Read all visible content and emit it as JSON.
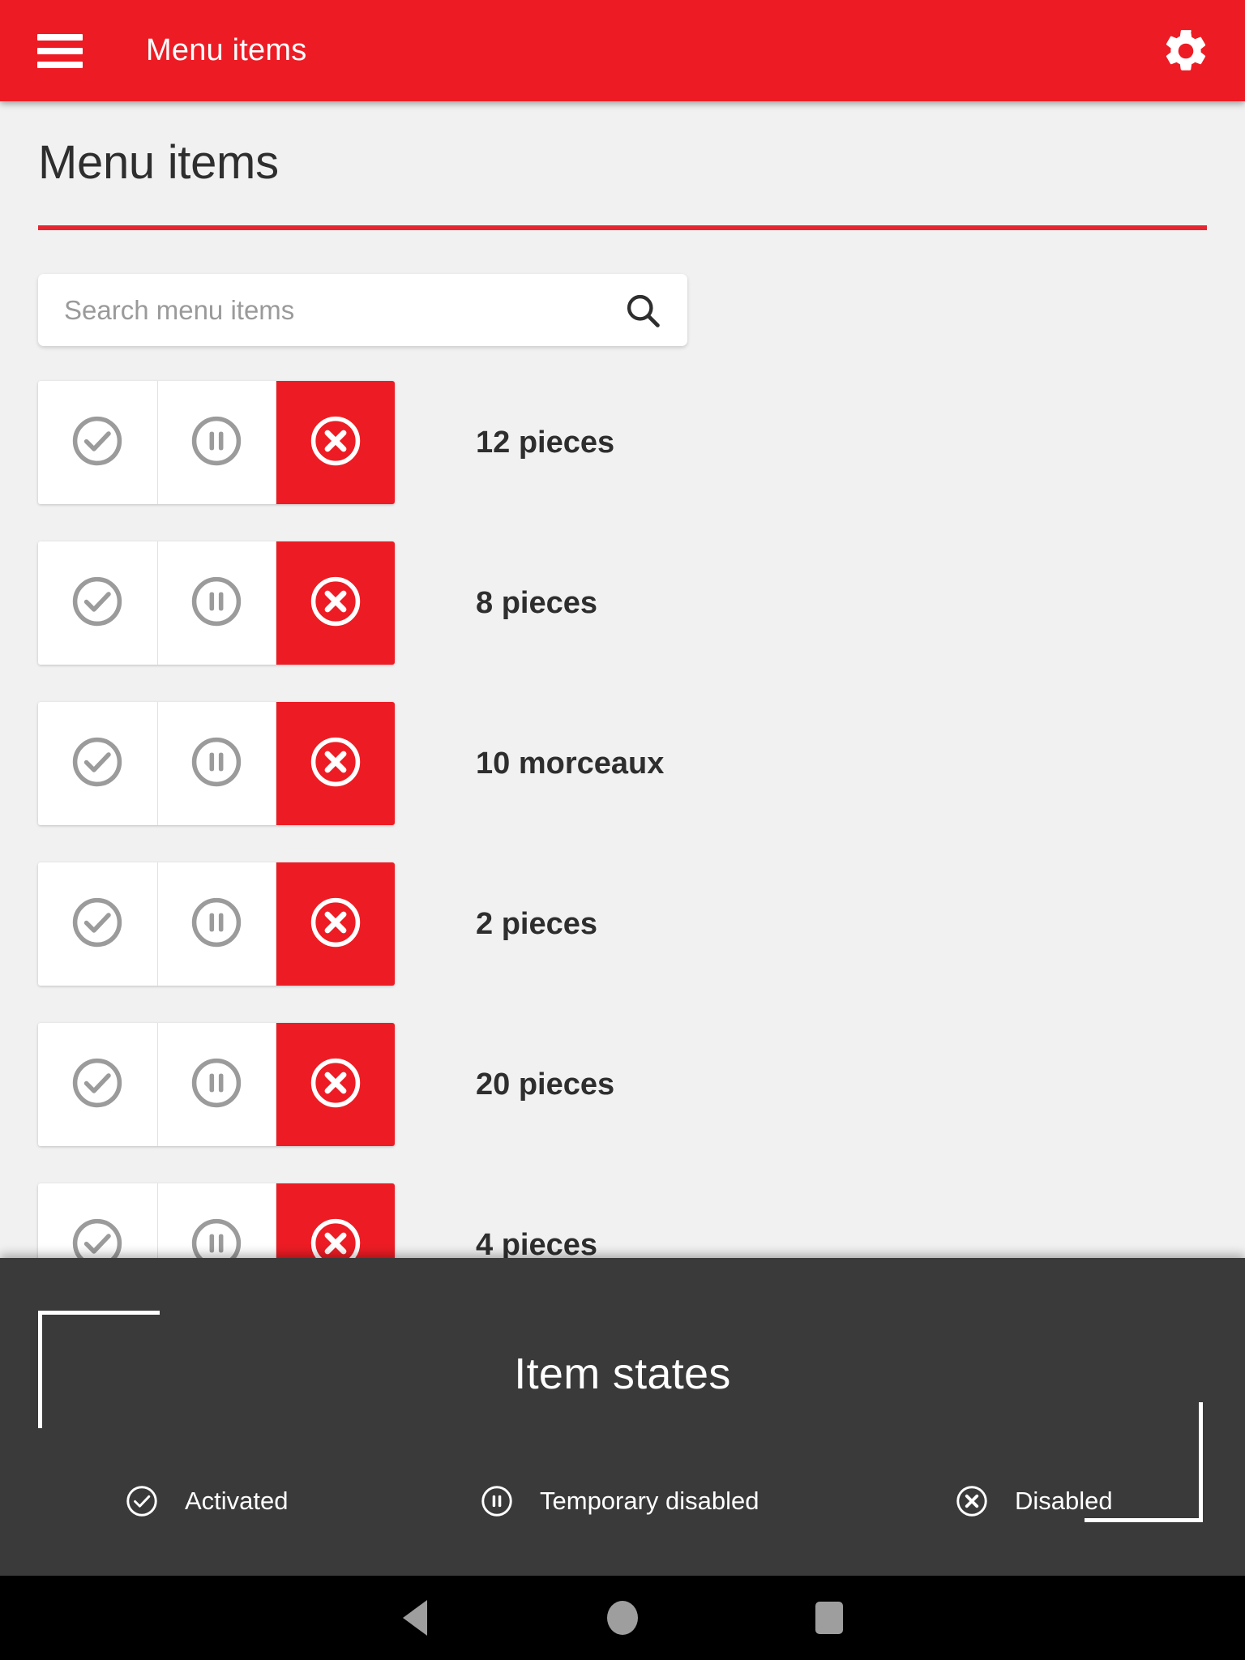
{
  "appbar": {
    "menu_icon": "hamburger-menu-icon",
    "title": "Menu items",
    "settings_icon": "gear-icon",
    "background_color": "#ed1c24"
  },
  "page": {
    "title": "Menu items",
    "accent_color": "#e52630",
    "background_color": "#f1f1f1"
  },
  "search": {
    "placeholder": "Search menu items",
    "value": "",
    "icon": "search-icon"
  },
  "list": {
    "state_icons": {
      "activated": "check-circle-icon",
      "temporary_disabled": "pause-circle-icon",
      "disabled": "x-circle-icon"
    },
    "items": [
      {
        "label": "12 pieces",
        "selected_state": "disabled"
      },
      {
        "label": "8 pieces",
        "selected_state": "disabled"
      },
      {
        "label": "10 morceaux",
        "selected_state": "disabled"
      },
      {
        "label": "2 pieces",
        "selected_state": "disabled"
      },
      {
        "label": "20 pieces",
        "selected_state": "disabled"
      },
      {
        "label": "4 pieces",
        "selected_state": "disabled"
      }
    ]
  },
  "states_panel": {
    "title": "Item states",
    "background_color": "#3a3a3a",
    "legend": [
      {
        "icon": "check-circle-icon",
        "label": "Activated"
      },
      {
        "icon": "pause-circle-icon",
        "label": "Temporary disabled"
      },
      {
        "icon": "x-circle-icon",
        "label": "Disabled"
      }
    ]
  },
  "navbar": {
    "back": "back-triangle-icon",
    "home": "home-circle-icon",
    "recents": "recents-square-icon"
  }
}
